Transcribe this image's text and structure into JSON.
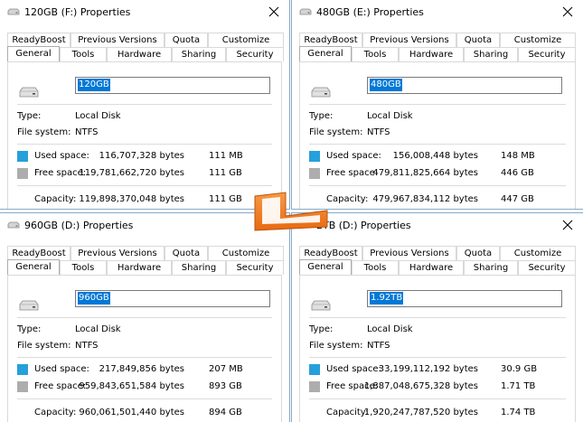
{
  "tabs": {
    "row1": [
      "ReadyBoost",
      "Previous Versions",
      "Quota",
      "Customize"
    ],
    "row2": [
      "General",
      "Tools",
      "Hardware",
      "Sharing",
      "Security"
    ]
  },
  "labels": {
    "type": "Type:",
    "file_system": "File system:",
    "used_space": "Used space:",
    "free_space": "Free space:",
    "capacity": "Capacity:"
  },
  "colors": {
    "used": "#26a0da",
    "free": "#adadad",
    "selection": "#0078d7",
    "logo": "#f47b20"
  },
  "windows": [
    {
      "title": "120GB (F:) Properties",
      "name": "120GB",
      "type": "Local Disk",
      "fs": "NTFS",
      "used_bytes": "116,707,328 bytes",
      "used_size": "111 MB",
      "free_bytes": "119,781,662,720 bytes",
      "free_size": "111 GB",
      "cap_bytes": "119,898,370,048 bytes",
      "cap_size": "111 GB"
    },
    {
      "title": "480GB (E:) Properties",
      "name": "480GB",
      "type": "Local Disk",
      "fs": "NTFS",
      "used_bytes": "156,008,448 bytes",
      "used_size": "148 MB",
      "free_bytes": "479,811,825,664 bytes",
      "free_size": "446 GB",
      "cap_bytes": "479,967,834,112 bytes",
      "cap_size": "447 GB"
    },
    {
      "title": "960GB (D:) Properties",
      "name": "960GB",
      "type": "Local Disk",
      "fs": "NTFS",
      "used_bytes": "217,849,856 bytes",
      "used_size": "207 MB",
      "free_bytes": "959,843,651,584 bytes",
      "free_size": "893 GB",
      "cap_bytes": "960,061,501,440 bytes",
      "cap_size": "894 GB"
    },
    {
      "title": "2TB (D:) Properties",
      "name": "1.92TB",
      "type": "Local Disk",
      "fs": "NTFS",
      "used_bytes": "33,199,112,192 bytes",
      "used_size": "30.9 GB",
      "free_bytes": "1,887,048,675,328 bytes",
      "free_size": "1.71 TB",
      "cap_bytes": "1,920,247,787,520 bytes",
      "cap_size": "1.74 TB"
    }
  ]
}
